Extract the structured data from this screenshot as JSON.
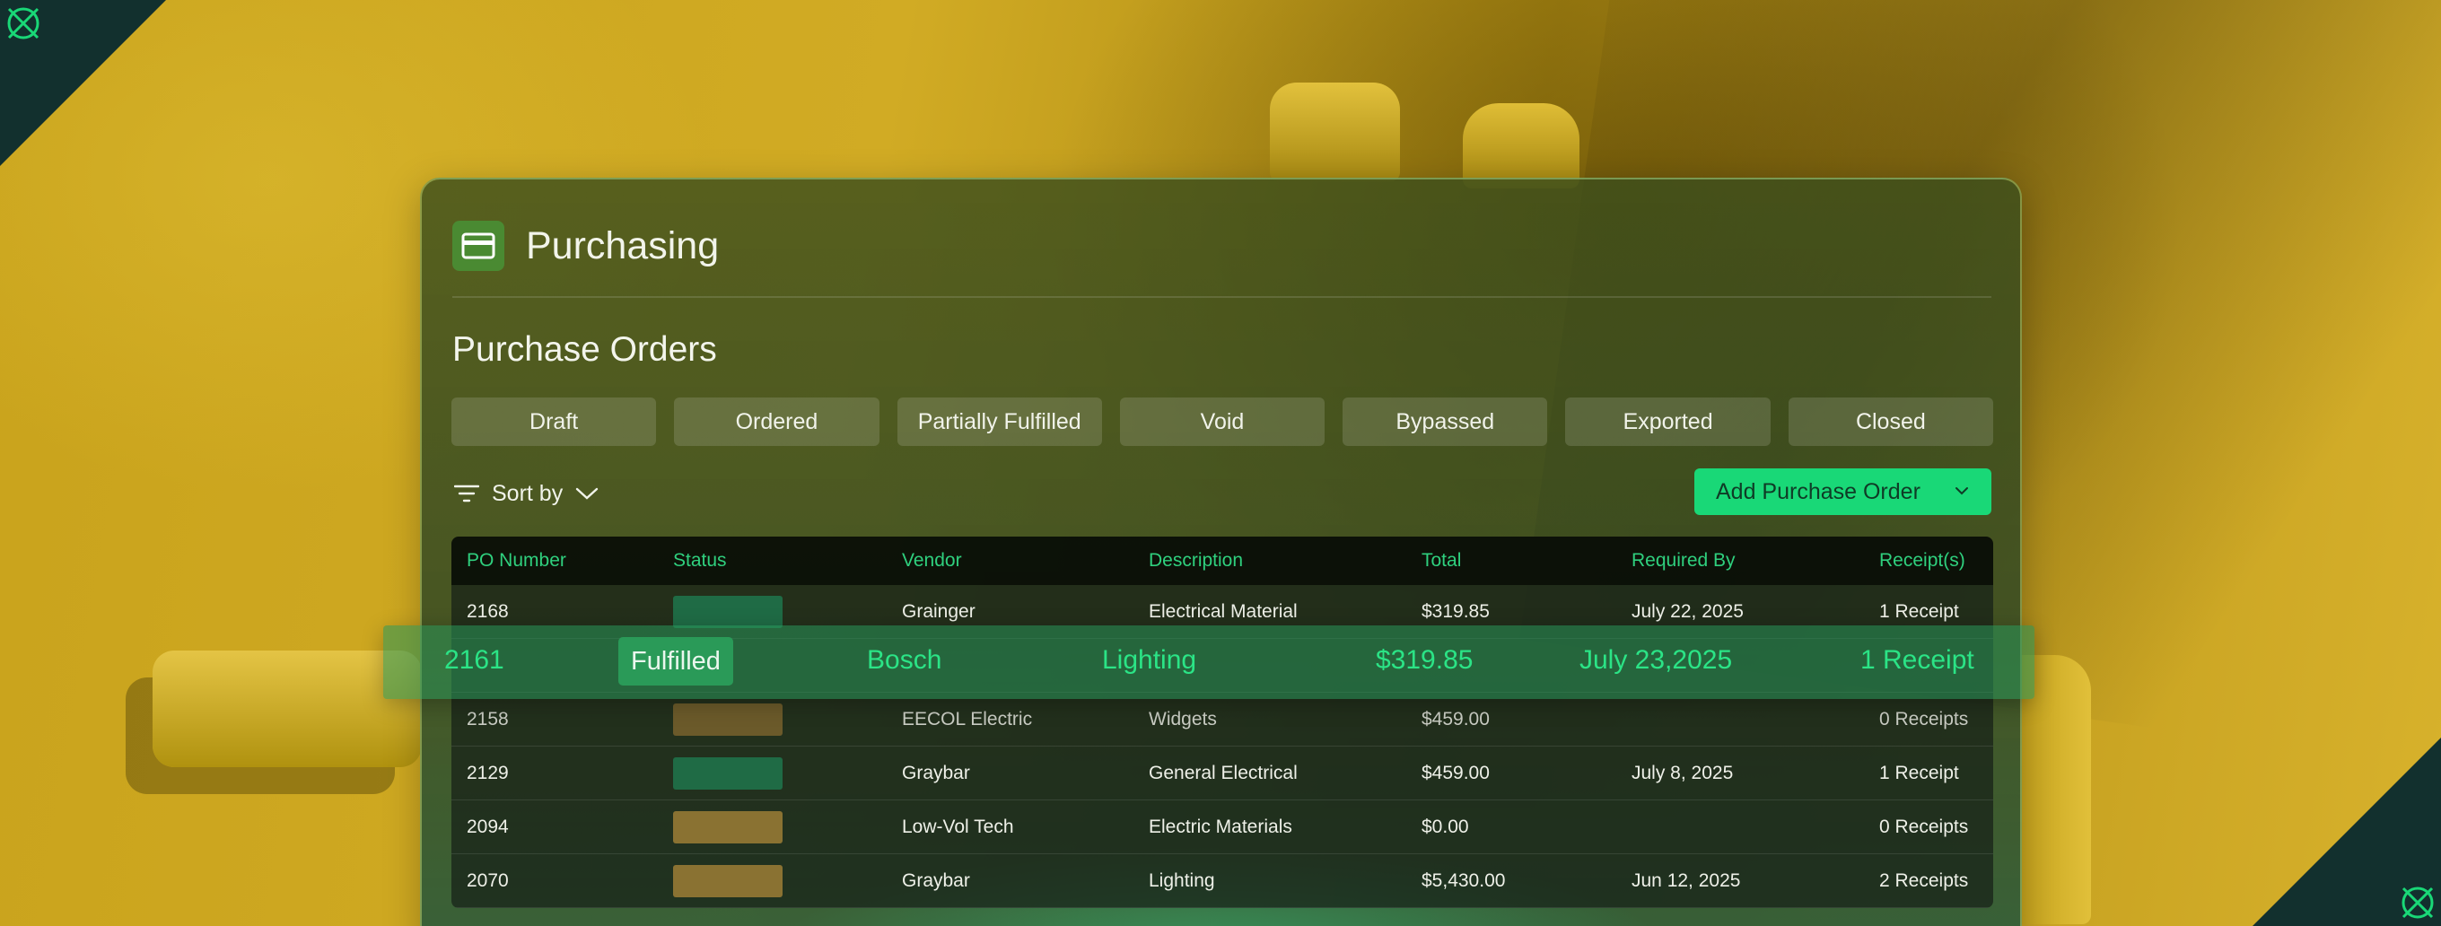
{
  "app": {
    "title": "Purchasing",
    "icon": "credit-card-icon"
  },
  "section": {
    "title": "Purchase Orders"
  },
  "filters": [
    "Draft",
    "Ordered",
    "Partially Fulfilled",
    "Void",
    "Bypassed",
    "Exported",
    "Closed"
  ],
  "toolbar": {
    "sort_label": "Sort by",
    "add_label": "Add Purchase Order"
  },
  "table": {
    "headers": [
      "PO Number",
      "Status",
      "Vendor",
      "Description",
      "Total",
      "Required By",
      "Receipt(s)"
    ],
    "rows": [
      {
        "po": "2168",
        "status_color": "#1f6b45",
        "vendor": "Grainger",
        "description": "Electrical Material",
        "total": "$319.85",
        "required_by": "July 22, 2025",
        "receipts": "1 Receipt"
      },
      {
        "po": "2158",
        "status_color": "#6b5a2a",
        "vendor": "EECOL Electric",
        "description": "Widgets",
        "total": "$459.00",
        "required_by": "",
        "receipts": "0 Receipts"
      },
      {
        "po": "2129",
        "status_color": "#1f6b45",
        "vendor": "Graybar",
        "description": "General Electrical",
        "total": "$459.00",
        "required_by": "July 8, 2025",
        "receipts": "1 Receipt"
      },
      {
        "po": "2094",
        "status_color": "#8a7232",
        "vendor": "Low-Vol Tech",
        "description": "Electric Materials",
        "total": "$0.00",
        "required_by": "",
        "receipts": "0 Receipts"
      },
      {
        "po": "2070",
        "status_color": "#8a7232",
        "vendor": "Graybar",
        "description": "Lighting",
        "total": "$5,430.00",
        "required_by": "Jun 12, 2025",
        "receipts": "2 Receipts"
      }
    ]
  },
  "highlight_row": {
    "po": "2161",
    "status": "Fulfilled",
    "vendor": "Bosch",
    "description": "Lighting",
    "total": "$319.85",
    "required_by": "July 23,2025",
    "receipts": "1 Receipt"
  },
  "colors": {
    "accent": "#19d877",
    "accent_text": "#2be486",
    "corner": "#12302e"
  }
}
